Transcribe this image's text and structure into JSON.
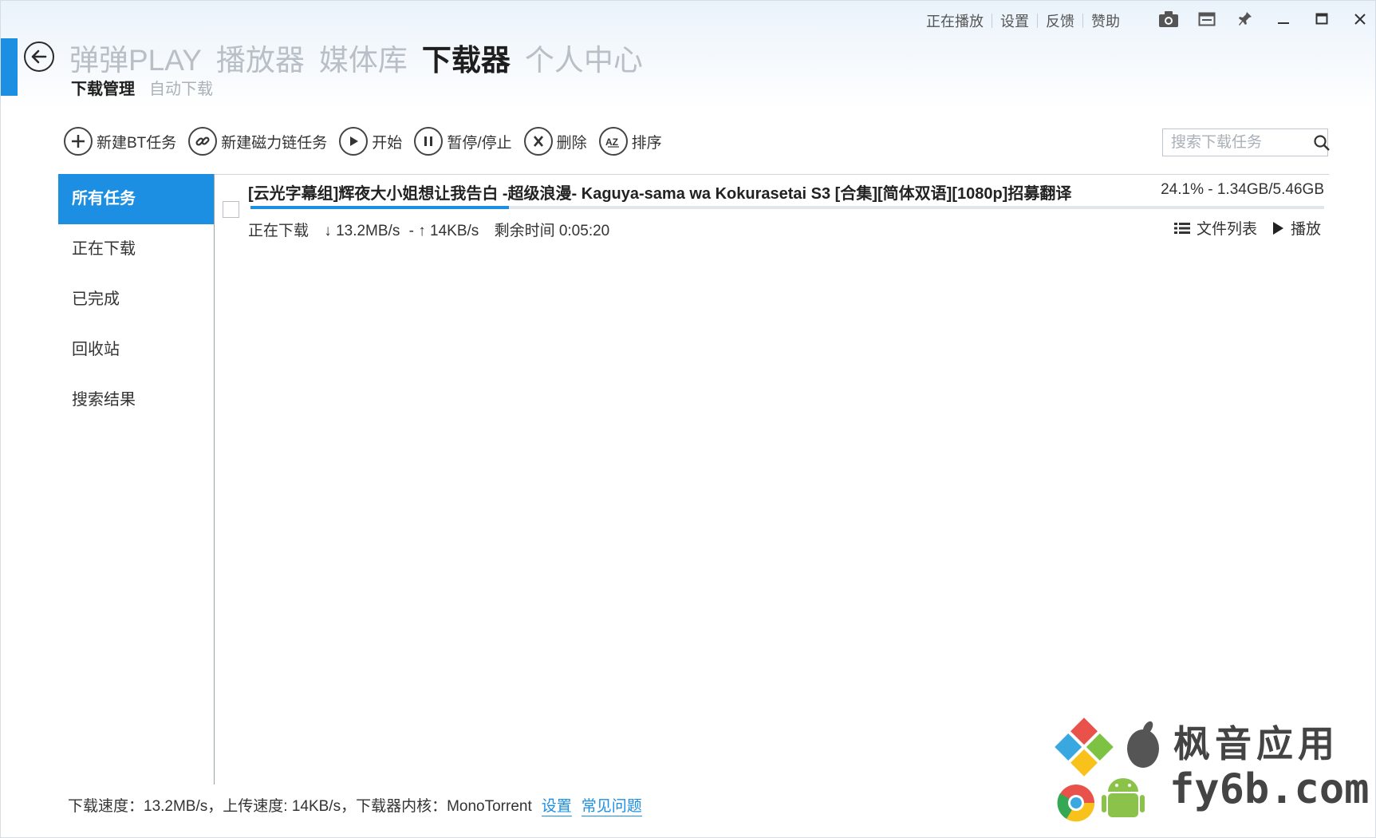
{
  "window_links": [
    "正在播放",
    "设置",
    "反馈",
    "赞助"
  ],
  "window_controls": [
    "camera-icon",
    "minimode-icon",
    "pin-icon",
    "minimize-icon",
    "maximize-icon",
    "close-icon"
  ],
  "main_nav": [
    "弹弹PLAY",
    "播放器",
    "媒体库",
    "下载器",
    "个人中心"
  ],
  "main_nav_active": "下载器",
  "sub_nav": [
    "下载管理",
    "自动下载"
  ],
  "sub_nav_active": "下载管理",
  "toolbar": {
    "new_bt": "新建BT任务",
    "new_magnet": "新建磁力链任务",
    "start": "开始",
    "pause": "暂停/停止",
    "delete": "删除",
    "sort": "排序"
  },
  "search": {
    "placeholder": "搜索下载任务"
  },
  "sidebar": [
    "所有任务",
    "正在下载",
    "已完成",
    "回收站",
    "搜索结果"
  ],
  "sidebar_active": "所有任务",
  "task": {
    "title": "[云光字幕组]辉夜大小姐想让我告白 -超级浪漫- Kaguya-sama wa Kokurasetai S3 [合集][简体双语][1080p]招募翻译",
    "progress_text": "24.1% - 1.34GB/5.46GB",
    "progress": 0.241,
    "state": "正在下载",
    "download_speed": "↓ 13.2MB/s",
    "upload_speed": "- ↑ 14KB/s",
    "remaining": "剩余时间 0:05:20",
    "file_list": "文件列表",
    "play": "播放"
  },
  "footer": {
    "status": "下载速度：13.2MB/s，上传速度: 14KB/s，下载器内核：MonoTorrent",
    "settings_link": "设置",
    "faq_link": "常见问题"
  },
  "watermark": {
    "line1": "枫音应用",
    "line2": "fy6b.com"
  },
  "colors": {
    "accent": "#1c8fe3",
    "inactive_nav": "#b9bfc6"
  }
}
